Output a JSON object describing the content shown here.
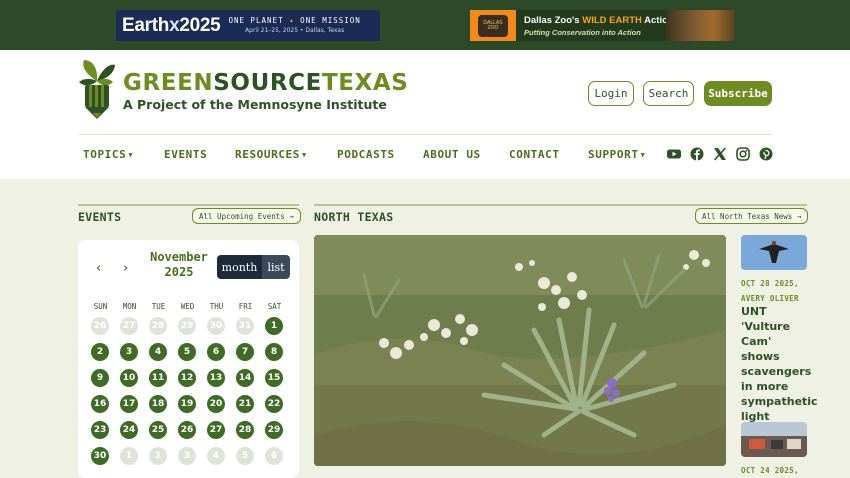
{
  "ads": {
    "earthx": {
      "brand_a": "Earth",
      "brand_b": "x",
      "brand_c": "2025",
      "motto_a": "ONE PLANET",
      "motto_b": "ONE MISSION",
      "details": "April 21–25, 2025 • Dallas, Texas"
    },
    "zoo": {
      "logo_text": "DALLAS ZOO",
      "title_a": "Dallas Zoo's ",
      "title_b": "WILD EARTH",
      "title_c": " Action Team",
      "subtitle": "Putting Conservation into Action"
    }
  },
  "site": {
    "name_a": "GREEN",
    "name_b": "SOURCE",
    "name_c": "TEXAS",
    "tagline": "A Project of the Memnosyne Institute"
  },
  "header_buttons": {
    "login": "Login",
    "search": "Search",
    "subscribe": "Subscribe"
  },
  "nav": [
    {
      "label": "TOPICS",
      "caret": "▼"
    },
    {
      "label": "EVENTS",
      "caret": ""
    },
    {
      "label": "RESOURCES",
      "caret": "▼"
    },
    {
      "label": "PODCASTS",
      "caret": ""
    },
    {
      "label": "ABOUT US",
      "caret": ""
    },
    {
      "label": "CONTACT",
      "caret": ""
    },
    {
      "label": "SUPPORT",
      "caret": "▼"
    }
  ],
  "social_icons": [
    "youtube-icon",
    "facebook-icon",
    "x-icon",
    "instagram-icon",
    "pinterest-icon"
  ],
  "events": {
    "title": "EVENTS",
    "link": "All Upcoming Events →",
    "calendar": {
      "prev": "‹",
      "next": "›",
      "month": "November",
      "year": "2025",
      "view_month": "month",
      "view_list": "list",
      "weekdays": [
        "SUN",
        "MON",
        "TUE",
        "WED",
        "THU",
        "FRI",
        "SAT"
      ],
      "weeks": [
        [
          "26",
          "27",
          "28",
          "29",
          "30",
          "31",
          "1"
        ],
        [
          "2",
          "3",
          "4",
          "5",
          "6",
          "7",
          "8"
        ],
        [
          "9",
          "10",
          "11",
          "12",
          "13",
          "14",
          "15"
        ],
        [
          "16",
          "17",
          "18",
          "19",
          "20",
          "21",
          "22"
        ],
        [
          "23",
          "24",
          "25",
          "26",
          "27",
          "28",
          "29"
        ],
        [
          "30",
          "1",
          "2",
          "3",
          "4",
          "5",
          "6"
        ]
      ],
      "in_month_flags": [
        [
          false,
          false,
          false,
          false,
          false,
          false,
          true
        ],
        [
          true,
          true,
          true,
          true,
          true,
          true,
          true
        ],
        [
          true,
          true,
          true,
          true,
          true,
          true,
          true
        ],
        [
          true,
          true,
          true,
          true,
          true,
          true,
          true
        ],
        [
          true,
          true,
          true,
          true,
          true,
          true,
          true
        ],
        [
          true,
          false,
          false,
          false,
          false,
          false,
          false
        ]
      ]
    }
  },
  "region": {
    "title": "NORTH TEXAS",
    "link": "All North Texas News →",
    "stories": [
      {
        "date": "OCT 28 2025,",
        "author": "AVERY OLIVER",
        "headline": "UNT 'Vulture Cam' shows scavengers in more sympathetic light"
      },
      {
        "date": "OCT 24 2025,"
      }
    ]
  },
  "colors": {
    "brand_green": "#6f8c22",
    "dark_green": "#2f5224",
    "page_bg": "#eef1e4",
    "calendar_day": "#3f6b26"
  }
}
